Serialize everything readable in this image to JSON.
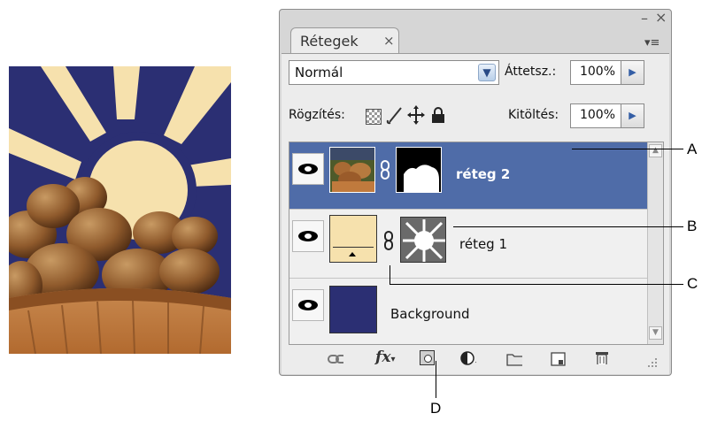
{
  "panel": {
    "tab_label": "Rétegek",
    "tab_close_glyph": "×",
    "minimize_glyph": "–",
    "close_glyph": "×",
    "menu_glyph": "▾≡"
  },
  "blend": {
    "mode": "Normál",
    "opacity_label": "Áttetsz.:",
    "opacity_value": "100%"
  },
  "lock": {
    "label": "Rögzítés:",
    "fill_label": "Kitöltés:",
    "fill_value": "100%"
  },
  "layers": [
    {
      "name": "réteg 2",
      "selected": true
    },
    {
      "name": "réteg 1",
      "selected": false
    },
    {
      "name": "Background",
      "selected": false
    }
  ],
  "callouts": {
    "a": "A",
    "b": "B",
    "c": "C",
    "d": "D"
  },
  "colors": {
    "selection": "#4f6ca8",
    "sky": "#2b2f73",
    "sun": "#f6e1ad"
  },
  "icons": [
    "link-layers-icon",
    "fx-icon",
    "add-mask-icon",
    "adjustment-layer-icon",
    "group-folder-icon",
    "new-layer-icon",
    "trash-icon",
    "eye-icon",
    "chain-link-icon"
  ]
}
